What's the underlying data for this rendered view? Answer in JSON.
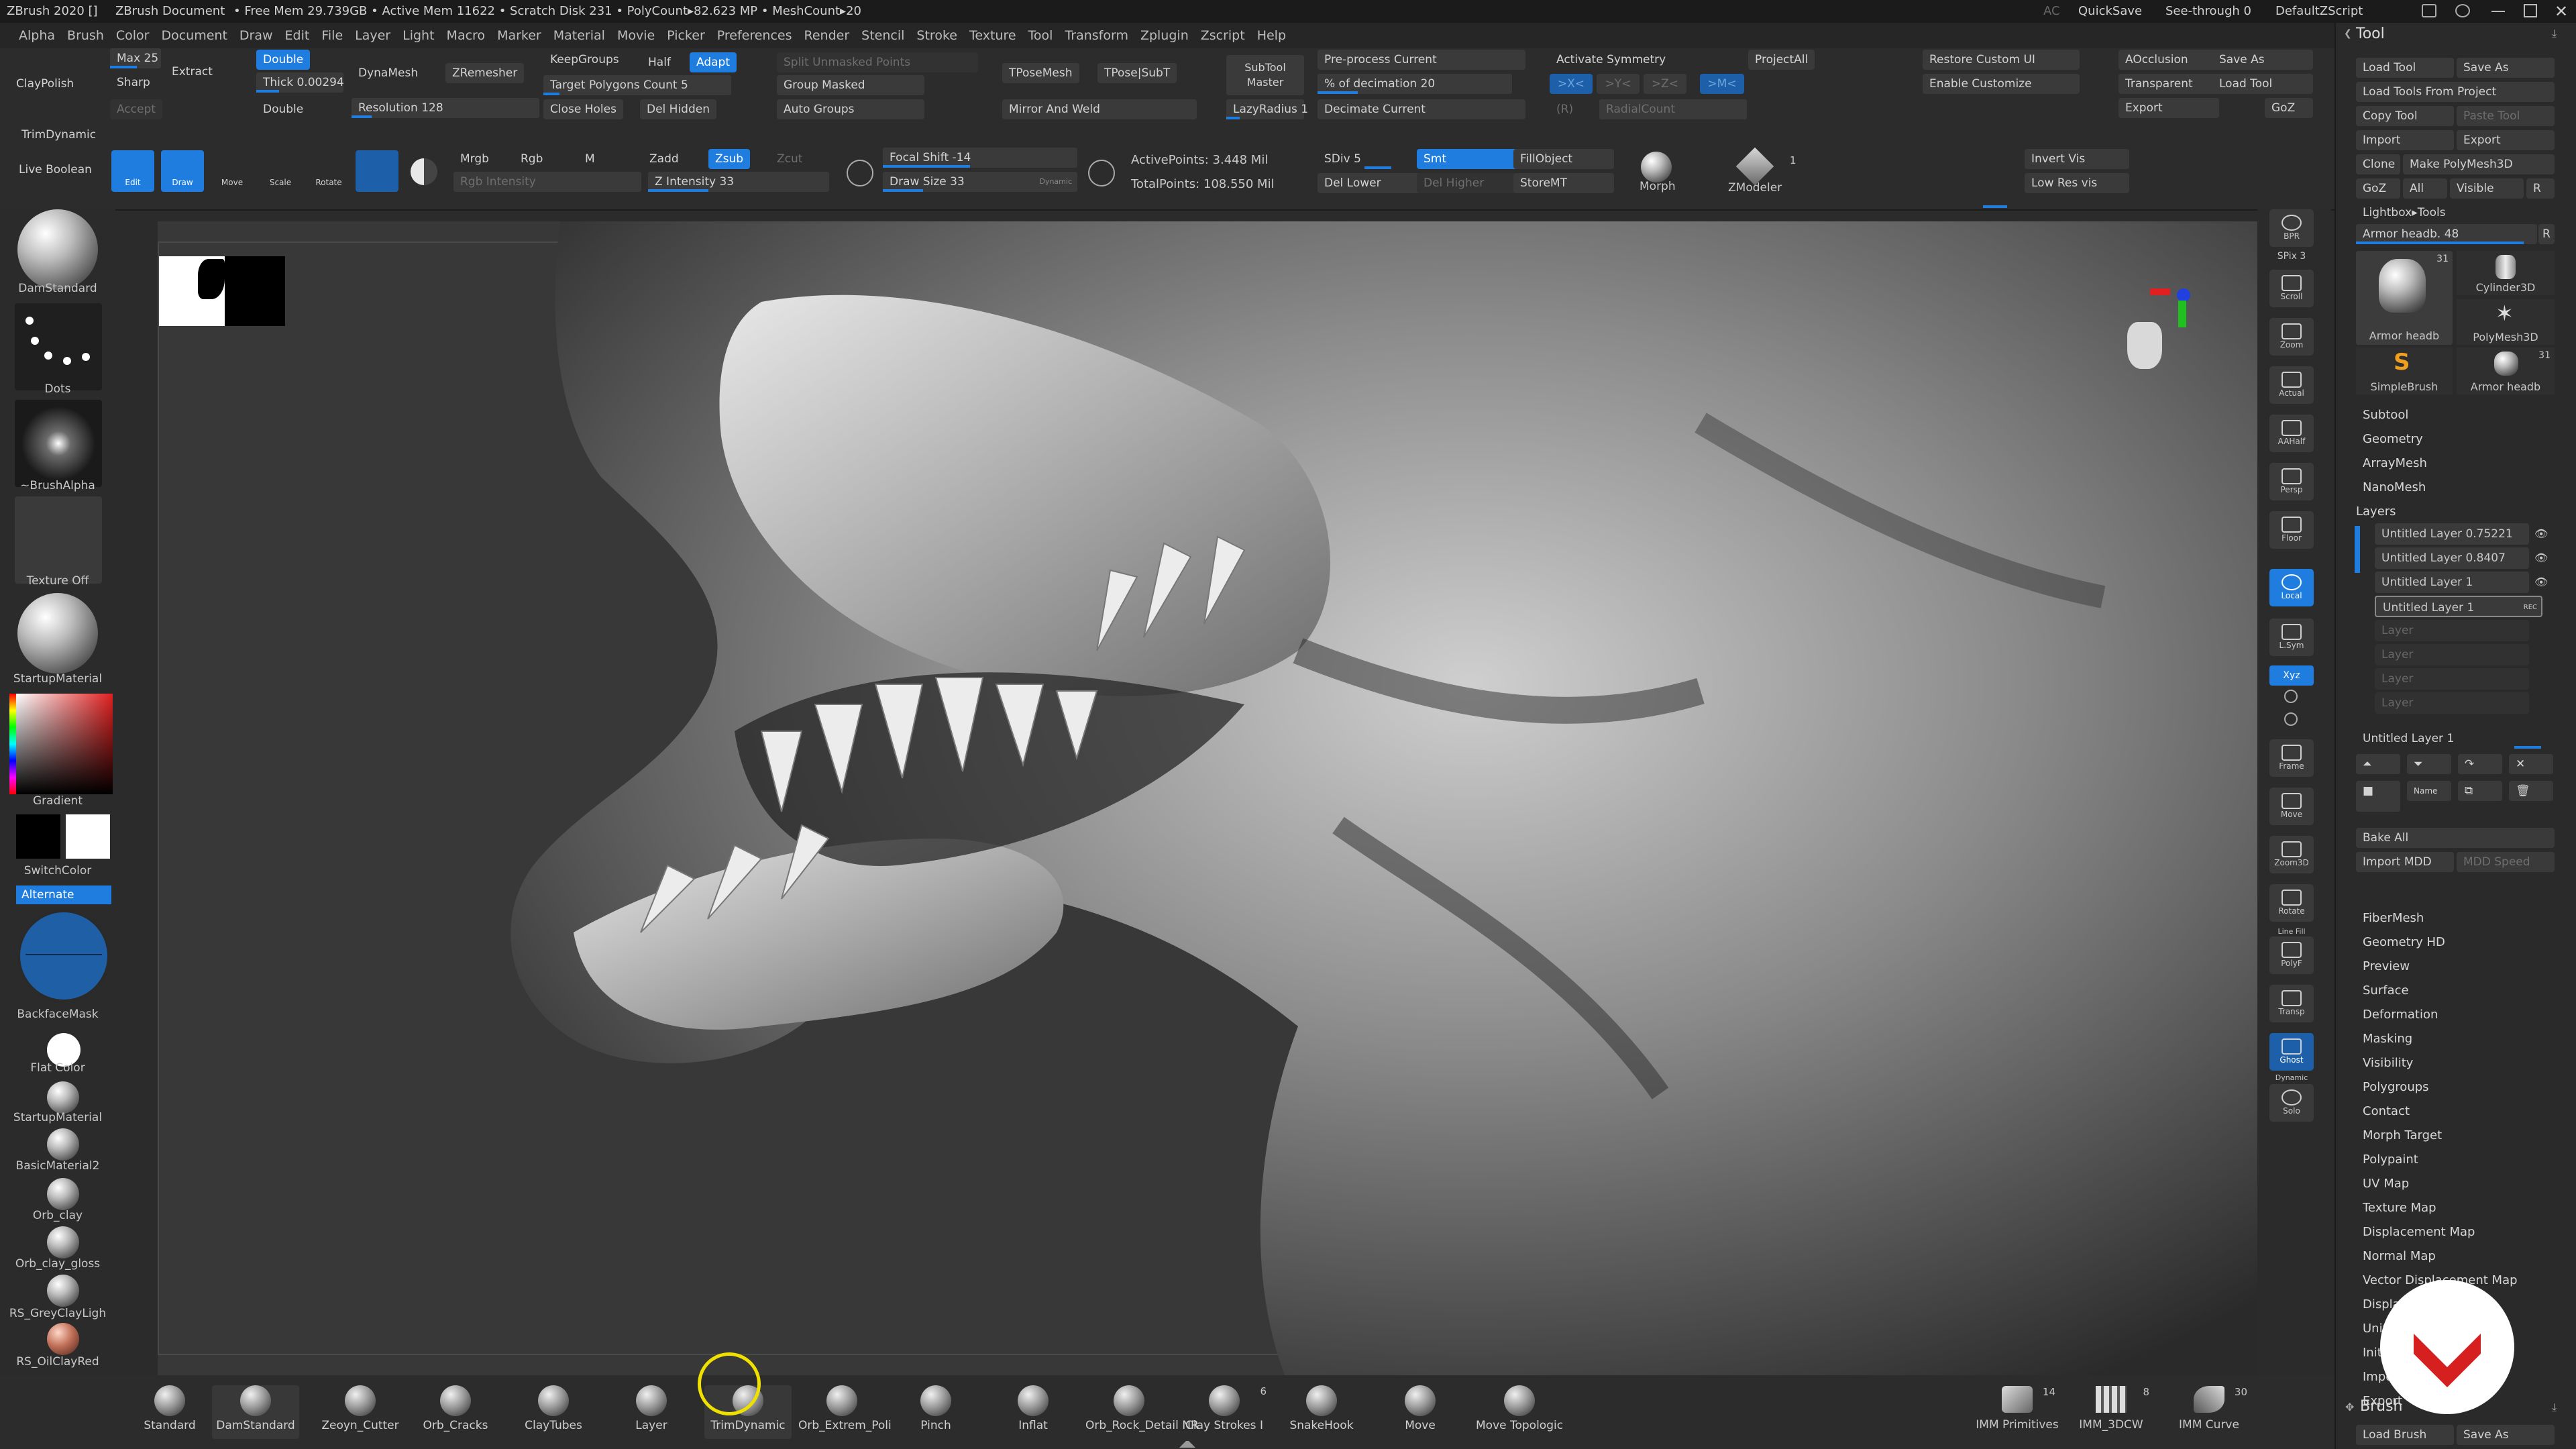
{
  "titlebar": {
    "app": "ZBrush 2020 []",
    "document": "ZBrush Document",
    "stats": "• Free Mem 29.739GB • Active Mem 11622 • Scratch Disk 231 • PolyCount▸82.623 MP • MeshCount▸20",
    "ac": "AC",
    "quicksave": "QuickSave",
    "seethrough": "See-through  0",
    "script": "DefaultZScript"
  },
  "menu": [
    "Alpha",
    "Brush",
    "Color",
    "Document",
    "Draw",
    "Edit",
    "File",
    "Layer",
    "Light",
    "Macro",
    "Marker",
    "Material",
    "Movie",
    "Picker",
    "Preferences",
    "Render",
    "Stencil",
    "Stroke",
    "Texture",
    "Tool",
    "Transform",
    "Zplugin",
    "Zscript",
    "Help"
  ],
  "shelf": {
    "claypolish": "ClayPolish",
    "max": "Max 25",
    "sharp": "Sharp",
    "accept": "Accept",
    "extract": "Extract",
    "double1": "Double",
    "thick": "Thick 0.00294",
    "double2": "Double",
    "dynamesh": "DynaMesh",
    "zremesher": "ZRemesher",
    "resolution": "Resolution 128",
    "keepgroups": "KeepGroups",
    "half": "Half",
    "adapt": "Adapt",
    "target": "Target Polygons Count 5",
    "closeholes": "Close Holes",
    "delhidden": "Del Hidden",
    "split": "Split Unmasked Points",
    "groupmasked": "Group Masked",
    "autogroups": "Auto Groups",
    "tposemesh": "TPoseMesh",
    "tposesubt": "TPose|SubT",
    "mirrorweld": "Mirror And Weld",
    "subtoolmaster": "SubTool Master",
    "lazyradius": "LazyRadius 1",
    "preprocess": "Pre-process Current",
    "decimation": "% of decimation 20",
    "decimatecurrent": "Decimate Current",
    "activatesym": "Activate Symmetry",
    "sym_x": ">X<",
    "sym_y": ">Y<",
    "sym_z": ">Z<",
    "sym_m": ">M<",
    "sym_r": "(R)",
    "radialcount": "RadialCount",
    "projectall": "ProjectAll",
    "restoreui": "Restore Custom UI",
    "enablecustomize": "Enable Customize",
    "aocclusion": "AOcclusion",
    "transparent": "Transparent",
    "export": "Export",
    "saveas": "Save As",
    "loadtool": "Load Tool",
    "goz": "GoZ",
    "trimdynamic": "TrimDynamic",
    "liveboolean": "Live Boolean",
    "edit": "Edit",
    "draw": "Draw",
    "move": "Move",
    "scale": "Scale",
    "rotate": "Rotate",
    "mrgb": "Mrgb",
    "rgb": "Rgb",
    "m": "M",
    "rgbintensity": "Rgb Intensity",
    "zadd": "Zadd",
    "zsub": "Zsub",
    "zcut": "Zcut",
    "zintensity": "Z Intensity 33",
    "focalshift": "Focal Shift -14",
    "drawsize": "Draw Size 33",
    "dynamic": "Dynamic",
    "activepoints": "ActivePoints: 3.448 Mil",
    "totalpoints": "TotalPoints: 108.550 Mil",
    "sdiv": "SDiv 5",
    "smt": "Smt",
    "fillobject": "FillObject",
    "dellower": "Del Lower",
    "delhigher": "Del Higher",
    "storemt": "StoreMT",
    "morph": "Morph",
    "zmodeler": "ZModeler",
    "zmodeler_count": "1",
    "invertvis": "Invert Vis",
    "lowresvis": "Low Res vis"
  },
  "left": {
    "items": [
      "DamStandard",
      "Dots",
      "~BrushAlpha",
      "Texture Off",
      "StartupMaterial"
    ],
    "gradient": "Gradient",
    "switchcolor": "SwitchColor",
    "alternate": "Alternate",
    "backfacemask": "BackfaceMask",
    "flatcolor": "Flat Color",
    "materials": [
      "StartupMaterial",
      "BasicMaterial2",
      "Orb_clay",
      "Orb_clay_gloss",
      "RS_GreyClayLigh",
      "RS_OilClayRed"
    ]
  },
  "right": {
    "buttons": [
      "BPR",
      "SPix 3",
      "Scroll",
      "Zoom",
      "Actual",
      "AAHalf",
      "Persp",
      "Floor",
      "Local",
      "L.Sym",
      "Xyz",
      "",
      "",
      "Frame",
      "Move",
      "Zoom3D",
      "Rotate",
      "PolyF",
      "Transp",
      "Ghost",
      "Solo"
    ],
    "dynamic": "Dynamic",
    "linefill": "Line Fill"
  },
  "toolpanel": {
    "title": "Tool",
    "loadtool": "Load Tool",
    "saveas": "Save As",
    "loadfromproject": "Load Tools From Project",
    "copytool": "Copy Tool",
    "pastetool": "Paste Tool",
    "import": "Import",
    "export": "Export",
    "clone": "Clone",
    "makepolymesh": "Make PolyMesh3D",
    "goz": "GoZ",
    "all": "All",
    "visible": "Visible",
    "r": "R",
    "lightbox": "Lightbox▸Tools",
    "armorslider": "Armor headb. 48",
    "thumbs": [
      {
        "label": "Armor headb",
        "count": "31"
      },
      {
        "label": "Cylinder3D",
        "count": ""
      },
      {
        "label": "PolyMesh3D",
        "count": ""
      },
      {
        "label": "SimpleBrush",
        "count": ""
      },
      {
        "label": "Armor headb",
        "count": "31"
      }
    ],
    "subpalettes1": [
      "Subtool",
      "Geometry",
      "ArrayMesh",
      "NanoMesh",
      "Layers"
    ],
    "layers": [
      "Untitled Layer 0.75221",
      "Untitled Layer 0.8407",
      "Untitled Layer 1",
      "Untitled Layer 1",
      "Layer",
      "Layer",
      "Layer",
      "Layer"
    ],
    "rec": "REC",
    "current_layer": "Untitled Layer 1",
    "name": "Name",
    "bakeall": "Bake All",
    "importmdd": "Import MDD",
    "mddspeed": "MDD Speed",
    "subpalettes2": [
      "FiberMesh",
      "Geometry HD",
      "Preview",
      "Surface",
      "Deformation",
      "Masking",
      "Visibility",
      "Polygroups",
      "Contact",
      "Morph Target",
      "Polypaint",
      "UV Map",
      "Texture Map",
      "Displacement Map",
      "Normal Map",
      "Vector Displacement Map",
      "Display",
      "Unif",
      "Init",
      "Impo",
      "Export"
    ],
    "brush_title": "Brush",
    "loadbrush": "Load Brush",
    "brush_saveas": "Save As"
  },
  "bottom": {
    "brushes": [
      "Standard",
      "DamStandard",
      "Zeoyn_Cutter",
      "Orb_Cracks",
      "ClayTubes",
      "Layer",
      "TrimDynamic",
      "Orb_Extrem_Poli",
      "Pinch",
      "Inflat",
      "Orb_Rock_Detail NR",
      "Clay Strokes I",
      "SnakeHook",
      "Move",
      "Move Topologic"
    ],
    "claystrokes_count": "6",
    "imm": [
      {
        "label": "IMM Primitives",
        "count": "14"
      },
      {
        "label": "IMM_3DCW",
        "count": "8"
      },
      {
        "label": "IMM Curve",
        "count": "30"
      }
    ]
  },
  "colors": {
    "accent": "#1f7de0",
    "bg": "#2b2b2b",
    "viewport": "#383838",
    "watermark": "#d61f1f"
  }
}
